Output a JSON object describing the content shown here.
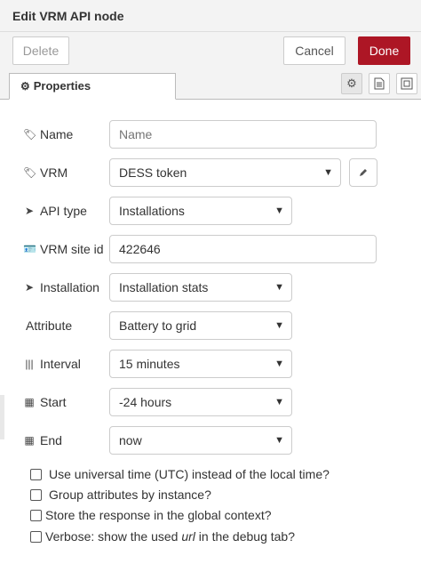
{
  "header": {
    "title": "Edit VRM API node"
  },
  "toolbar": {
    "delete_label": "Delete",
    "cancel_label": "Cancel",
    "done_label": "Done"
  },
  "tabs": {
    "properties_label": "Properties"
  },
  "form": {
    "name": {
      "label": "Name",
      "placeholder": "Name",
      "value": ""
    },
    "vrm": {
      "label": "VRM",
      "value": "DESS token"
    },
    "api_type": {
      "label": "API type",
      "value": "Installations"
    },
    "site_id": {
      "label": "VRM site id",
      "value": "422646"
    },
    "installation": {
      "label": "Installation",
      "value": "Installation stats"
    },
    "attribute": {
      "label": "Attribute",
      "value": "Battery to grid"
    },
    "interval": {
      "label": "Interval",
      "value": "15 minutes"
    },
    "start": {
      "label": "Start",
      "value": "-24 hours"
    },
    "end": {
      "label": "End",
      "value": "now"
    }
  },
  "options": {
    "utc": "Use universal time (UTC) instead of the local time?",
    "group": "Group attributes by instance?",
    "store": "Store the response in the global context?",
    "verbose_prefix": "Verbose: show the used ",
    "verbose_em": "url",
    "verbose_suffix": " in the debug tab?"
  },
  "colors": {
    "done": "#ad1625",
    "header_bg": "#f3f3f3"
  },
  "icons": [
    "gear-icon",
    "description-icon",
    "appearance-icon",
    "tag-icon",
    "pencil-icon",
    "send-arrow-icon",
    "id-card-icon",
    "barcode-icon",
    "calendar-icon",
    "chevron-down-icon"
  ]
}
